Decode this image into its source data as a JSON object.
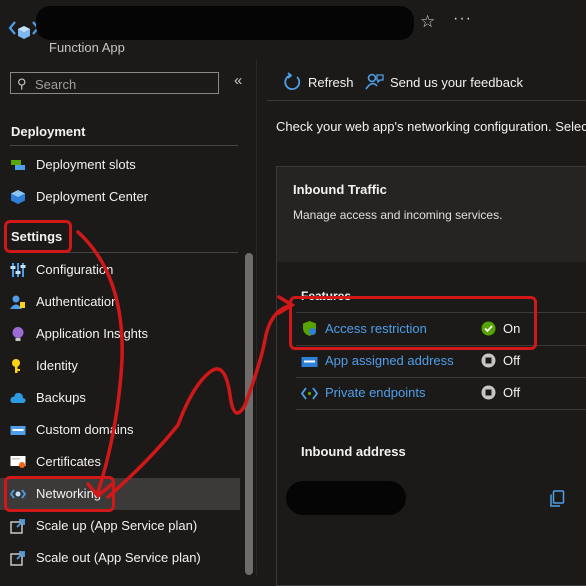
{
  "header": {
    "subtitle": "Function App",
    "star_symbol": "☆",
    "more_symbol": "···"
  },
  "sidebar": {
    "search_placeholder": "Search",
    "collapse_symbol": "«",
    "section_deployment": "Deployment",
    "section_settings": "Settings",
    "items": [
      {
        "label": "Deployment slots",
        "icon": "deployment-slots-icon"
      },
      {
        "label": "Deployment Center",
        "icon": "deployment-center-icon"
      },
      {
        "label": "Configuration",
        "icon": "configuration-icon"
      },
      {
        "label": "Authentication",
        "icon": "authentication-icon"
      },
      {
        "label": "Application Insights",
        "icon": "application-insights-icon"
      },
      {
        "label": "Identity",
        "icon": "identity-icon"
      },
      {
        "label": "Backups",
        "icon": "backups-icon"
      },
      {
        "label": "Custom domains",
        "icon": "custom-domains-icon"
      },
      {
        "label": "Certificates",
        "icon": "certificates-icon"
      },
      {
        "label": "Networking",
        "icon": "networking-icon",
        "active": true
      },
      {
        "label": "Scale up (App Service plan)",
        "icon": "scale-up-icon"
      },
      {
        "label": "Scale out (App Service plan)",
        "icon": "scale-out-icon"
      }
    ]
  },
  "toolbar": {
    "refresh_label": "Refresh",
    "feedback_label": "Send us your feedback"
  },
  "main": {
    "description": "Check your web app's networking configuration. Selec",
    "inbound": {
      "title": "Inbound Traffic",
      "subtitle": "Manage access and incoming services.",
      "features_heading": "Features",
      "features": [
        {
          "label": "Access restriction",
          "status": "On",
          "status_color": "#57a300"
        },
        {
          "label": "App assigned address",
          "status": "Off",
          "status_color": "#c8c6c4"
        },
        {
          "label": "Private endpoints",
          "status": "Off",
          "status_color": "#c8c6c4"
        }
      ],
      "address_heading": "Inbound address"
    }
  },
  "colors": {
    "accent": "#4f9ee8",
    "annotation_red": "#d01818",
    "background": "#1b1a19"
  }
}
